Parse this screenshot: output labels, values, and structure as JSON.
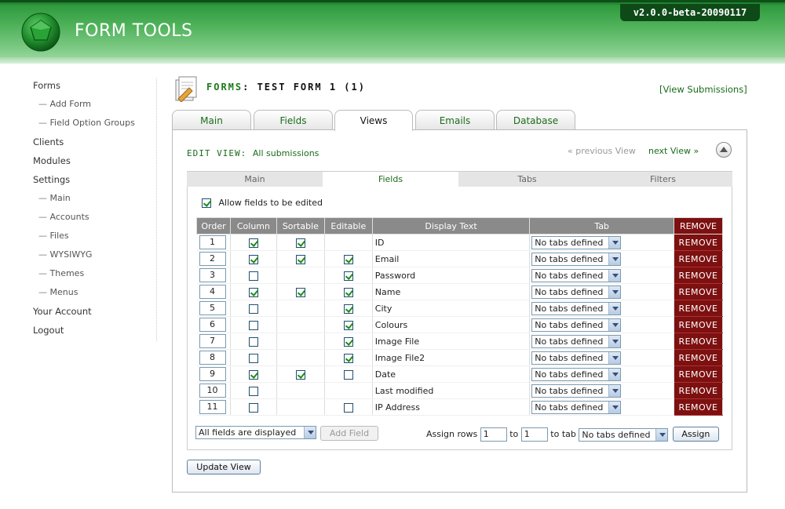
{
  "header": {
    "app_name": "FORM TOOLS",
    "version": "v2.0.0-beta-20090117",
    "colors": {
      "brand_green": "#2f9a3e",
      "dark_green": "#0e4a17"
    }
  },
  "sidebar": {
    "items": [
      {
        "label": "Forms",
        "sub": false
      },
      {
        "label": "Add Form",
        "sub": true
      },
      {
        "label": "Field Option Groups",
        "sub": true
      },
      {
        "label": "Clients",
        "sub": false
      },
      {
        "label": "Modules",
        "sub": false
      },
      {
        "label": "Settings",
        "sub": false
      },
      {
        "label": "Main",
        "sub": true
      },
      {
        "label": "Accounts",
        "sub": true
      },
      {
        "label": "Files",
        "sub": true
      },
      {
        "label": "WYSIWYG",
        "sub": true
      },
      {
        "label": "Themes",
        "sub": true
      },
      {
        "label": "Menus",
        "sub": true
      },
      {
        "label": "Your Account",
        "sub": false
      },
      {
        "label": "Logout",
        "sub": false
      }
    ]
  },
  "page": {
    "title_prefix": "FORMS",
    "title_rest": ": TEST FORM 1 (1)",
    "view_submissions": "[View Submissions]"
  },
  "tabs": [
    "Main",
    "Fields",
    "Views",
    "Emails",
    "Database"
  ],
  "active_tab": "Views",
  "edit_view": {
    "label": "EDIT VIEW:",
    "view_name": "All submissions",
    "previous": "« previous View",
    "next": "next View »"
  },
  "subtabs": [
    "Main",
    "Fields",
    "Tabs",
    "Filters"
  ],
  "active_subtab": "Fields",
  "allow_edit_label": "Allow fields to be edited",
  "table": {
    "headers": [
      "Order",
      "Column",
      "Sortable",
      "Editable",
      "Display Text",
      "Tab",
      "REMOVE"
    ],
    "rows": [
      {
        "order": "1",
        "column": true,
        "sortable": true,
        "editable": null,
        "display": "ID",
        "tab": "No tabs defined"
      },
      {
        "order": "2",
        "column": true,
        "sortable": true,
        "editable": true,
        "display": "Email",
        "tab": "No tabs defined"
      },
      {
        "order": "3",
        "column": false,
        "sortable": null,
        "editable": true,
        "display": "Password",
        "tab": "No tabs defined"
      },
      {
        "order": "4",
        "column": true,
        "sortable": true,
        "editable": true,
        "display": "Name",
        "tab": "No tabs defined"
      },
      {
        "order": "5",
        "column": false,
        "sortable": null,
        "editable": true,
        "display": "City",
        "tab": "No tabs defined"
      },
      {
        "order": "6",
        "column": false,
        "sortable": null,
        "editable": true,
        "display": "Colours",
        "tab": "No tabs defined"
      },
      {
        "order": "7",
        "column": false,
        "sortable": null,
        "editable": true,
        "display": "Image File",
        "tab": "No tabs defined"
      },
      {
        "order": "8",
        "column": false,
        "sortable": null,
        "editable": true,
        "display": "Image File2",
        "tab": "No tabs defined"
      },
      {
        "order": "9",
        "column": true,
        "sortable": true,
        "editable": false,
        "display": "Date",
        "tab": "No tabs defined"
      },
      {
        "order": "10",
        "column": false,
        "sortable": null,
        "editable": null,
        "display": "Last modified",
        "tab": "No tabs defined"
      },
      {
        "order": "11",
        "column": false,
        "sortable": null,
        "editable": false,
        "display": "IP Address",
        "tab": "No tabs defined"
      }
    ],
    "remove_label": "REMOVE"
  },
  "bottom": {
    "display_select": "All fields are displayed",
    "add_field": "Add Field",
    "assign_rows_label": "Assign rows",
    "from": "1",
    "to_label": "to",
    "to": "1",
    "to_tab_label": "to tab",
    "tab_select": "No tabs defined",
    "assign_button": "Assign"
  },
  "update_button": "Update View"
}
